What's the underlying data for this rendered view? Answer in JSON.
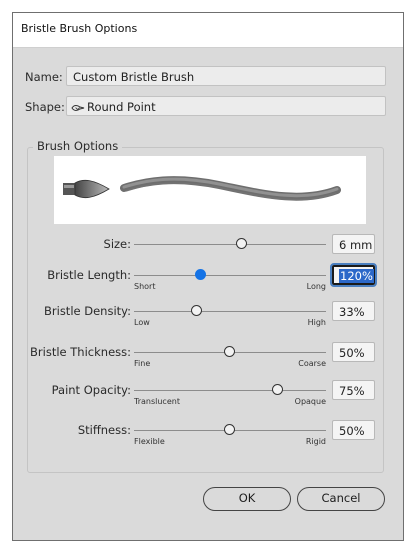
{
  "dialog": {
    "title": "Bristle Brush Options"
  },
  "name": {
    "label": "Name:",
    "value": "Custom Bristle Brush"
  },
  "shape": {
    "label": "Shape:",
    "value": "Round Point",
    "icon": "round-point-brush-icon"
  },
  "brush_options": {
    "title": "Brush Options"
  },
  "sliders": [
    {
      "label": "Size:",
      "value": "6 mm",
      "min_label": "",
      "max_label": "",
      "level": 0.56,
      "active": false
    },
    {
      "label": "Bristle Length:",
      "value": "120%",
      "min_label": "Short",
      "max_label": "Long",
      "level": 0.35,
      "active": true
    },
    {
      "label": "Bristle Density:",
      "value": "33%",
      "min_label": "Low",
      "max_label": "High",
      "level": 0.33,
      "active": false
    },
    {
      "label": "Bristle Thickness:",
      "value": "50%",
      "min_label": "Fine",
      "max_label": "Coarse",
      "level": 0.5,
      "active": false
    },
    {
      "label": "Paint Opacity:",
      "value": "75%",
      "min_label": "Translucent",
      "max_label": "Opaque",
      "level": 0.75,
      "active": false
    },
    {
      "label": "Stiffness:",
      "value": "50%",
      "min_label": "Flexible",
      "max_label": "Rigid",
      "level": 0.5,
      "active": false
    }
  ],
  "buttons": {
    "ok": "OK",
    "cancel": "Cancel"
  },
  "colors": {
    "accent": "#1473e6",
    "dialog_bg": "#dadada"
  }
}
